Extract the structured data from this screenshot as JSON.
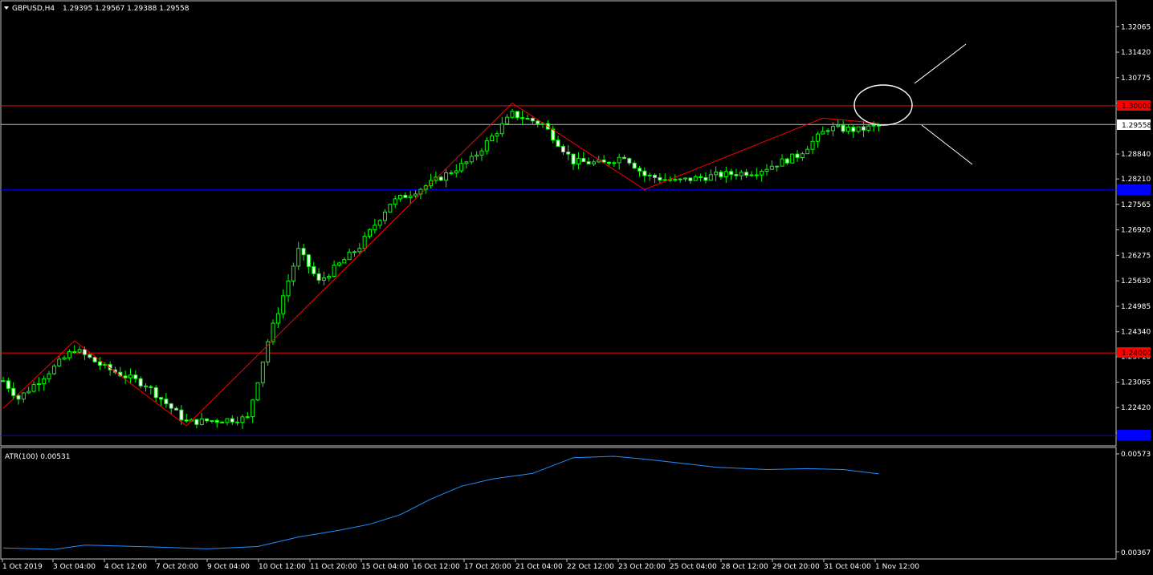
{
  "header": {
    "symbol": "GBPUSD,H4",
    "ohlc": "1.29395 1.29567 1.29388 1.29558"
  },
  "indicator": {
    "label": "ATR(100) 0.00531",
    "top_value": "0.00573",
    "bottom_value": "0.00367"
  },
  "colors": {
    "background": "#000000",
    "bull_candle": "#000000",
    "bear_candle": "#ffffff",
    "wick": "#00ff00",
    "resistance": "#ff0000",
    "support": "#0000ff",
    "bid_line": "#c0c0c0",
    "zigzag": "#ff0000",
    "atr": "#1e90ff"
  },
  "price_tags": {
    "resistance_high": "1.30000",
    "bid": "1.29558",
    "resistance_low": "1.24000"
  },
  "chart_data": {
    "type": "candlestick",
    "symbol": "GBPUSD",
    "timeframe": "H4",
    "ylim": [
      1.2145,
      1.327
    ],
    "y_ticks": [
      1.32065,
      1.3142,
      1.30775,
      1.3013,
      1.2884,
      1.2821,
      1.27565,
      1.2692,
      1.26275,
      1.2563,
      1.24985,
      1.2434,
      1.2371,
      1.23065,
      1.2242,
      1.21775
    ],
    "x_labels": [
      "1 Oct 2019",
      "3 Oct 04:00",
      "4 Oct 12:00",
      "7 Oct 20:00",
      "9 Oct 04:00",
      "10 Oct 12:00",
      "11 Oct 20:00",
      "15 Oct 04:00",
      "16 Oct 12:00",
      "17 Oct 20:00",
      "21 Oct 04:00",
      "22 Oct 12:00",
      "23 Oct 20:00",
      "25 Oct 04:00",
      "28 Oct 12:00",
      "29 Oct 20:00",
      "31 Oct 04:00",
      "1 Nov 12:00"
    ],
    "horizontal_lines": [
      {
        "kind": "resistance",
        "price": 1.3
      },
      {
        "kind": "bid",
        "price": 1.29558
      },
      {
        "kind": "support",
        "price": 1.28
      },
      {
        "kind": "resistance",
        "price": 1.24
      },
      {
        "kind": "support",
        "price": 1.22
      }
    ],
    "zigzag": [
      {
        "bar": 0,
        "price": 1.224
      },
      {
        "bar": 14,
        "price": 1.2411
      },
      {
        "bar": 36,
        "price": 1.2196
      },
      {
        "bar": 100,
        "price": 1.3013
      },
      {
        "bar": 126,
        "price": 1.2794
      },
      {
        "bar": 161,
        "price": 1.2975
      },
      {
        "bar": 172,
        "price": 1.2962
      }
    ],
    "key_points": [
      {
        "bar": 0,
        "price": 1.231
      },
      {
        "bar": 3,
        "price": 1.2265
      },
      {
        "bar": 14,
        "price": 1.239
      },
      {
        "bar": 20,
        "price": 1.2343
      },
      {
        "bar": 28,
        "price": 1.23
      },
      {
        "bar": 36,
        "price": 1.2205
      },
      {
        "bar": 48,
        "price": 1.2215
      },
      {
        "bar": 52,
        "price": 1.241
      },
      {
        "bar": 58,
        "price": 1.264
      },
      {
        "bar": 62,
        "price": 1.256
      },
      {
        "bar": 70,
        "price": 1.265
      },
      {
        "bar": 76,
        "price": 1.276
      },
      {
        "bar": 84,
        "price": 1.281
      },
      {
        "bar": 92,
        "price": 1.287
      },
      {
        "bar": 100,
        "price": 1.2985
      },
      {
        "bar": 106,
        "price": 1.296
      },
      {
        "bar": 112,
        "price": 1.2865
      },
      {
        "bar": 118,
        "price": 1.286
      },
      {
        "bar": 122,
        "price": 1.288
      },
      {
        "bar": 126,
        "price": 1.283
      },
      {
        "bar": 132,
        "price": 1.2815
      },
      {
        "bar": 140,
        "price": 1.283
      },
      {
        "bar": 148,
        "price": 1.284
      },
      {
        "bar": 156,
        "price": 1.288
      },
      {
        "bar": 162,
        "price": 1.295
      },
      {
        "bar": 168,
        "price": 1.2945
      },
      {
        "bar": 172,
        "price": 1.2956
      }
    ],
    "atr": {
      "label": "ATR(100)",
      "last": 0.00531,
      "ylim": [
        0.00367,
        0.00573
      ],
      "points": [
        {
          "bar": 0,
          "value": 0.00375
        },
        {
          "bar": 10,
          "value": 0.00372
        },
        {
          "bar": 16,
          "value": 0.00381
        },
        {
          "bar": 30,
          "value": 0.00377
        },
        {
          "bar": 40,
          "value": 0.00373
        },
        {
          "bar": 50,
          "value": 0.00378
        },
        {
          "bar": 58,
          "value": 0.00398
        },
        {
          "bar": 66,
          "value": 0.00412
        },
        {
          "bar": 72,
          "value": 0.00425
        },
        {
          "bar": 78,
          "value": 0.00445
        },
        {
          "bar": 84,
          "value": 0.00478
        },
        {
          "bar": 90,
          "value": 0.00505
        },
        {
          "bar": 96,
          "value": 0.0052
        },
        {
          "bar": 104,
          "value": 0.00532
        },
        {
          "bar": 112,
          "value": 0.00565
        },
        {
          "bar": 120,
          "value": 0.00568
        },
        {
          "bar": 126,
          "value": 0.00562
        },
        {
          "bar": 132,
          "value": 0.00555
        },
        {
          "bar": 140,
          "value": 0.00545
        },
        {
          "bar": 150,
          "value": 0.0054
        },
        {
          "bar": 158,
          "value": 0.00542
        },
        {
          "bar": 165,
          "value": 0.0054
        },
        {
          "bar": 172,
          "value": 0.00531
        }
      ]
    }
  }
}
